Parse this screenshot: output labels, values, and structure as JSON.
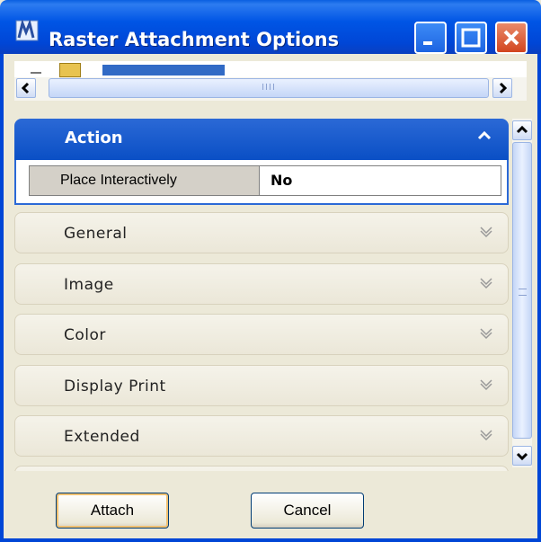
{
  "window": {
    "title": "Raster Attachment Options",
    "buttons": {
      "minimize": "minimize-icon",
      "maximize": "maximize-icon",
      "close": "close-icon"
    }
  },
  "tree": {
    "scroll_left": "◀",
    "scroll_right": "▶"
  },
  "action": {
    "header_label": "Action",
    "property_name": "Place Interactively",
    "property_value": "No"
  },
  "groups": [
    {
      "label": "General"
    },
    {
      "label": "Image"
    },
    {
      "label": "Color"
    },
    {
      "label": "Display Print"
    },
    {
      "label": "Extended"
    }
  ],
  "buttons": {
    "attach": "Attach",
    "cancel": "Cancel"
  },
  "colors": {
    "titlebar": "#0055e5",
    "panel_header": "#2b69d6",
    "close_button": "#d2451f"
  }
}
